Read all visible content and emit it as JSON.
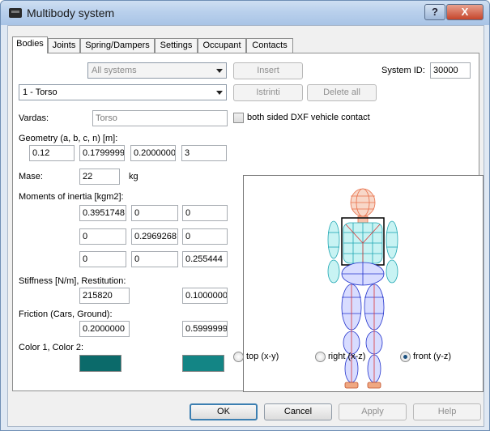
{
  "window": {
    "title": "Multibody system",
    "help_glyph": "?",
    "close_glyph": "X"
  },
  "tabs": [
    {
      "label": "Bodies"
    },
    {
      "label": "Joints"
    },
    {
      "label": "Spring/Dampers"
    },
    {
      "label": "Settings"
    },
    {
      "label": "Occupant"
    },
    {
      "label": "Contacts"
    }
  ],
  "systems_dropdown": {
    "value": "All systems"
  },
  "body_dropdown": {
    "value": "1 - Torso"
  },
  "buttons": {
    "insert": "Insert",
    "delete": "Istrinti",
    "delete_all": "Delete all",
    "ok": "OK",
    "cancel": "Cancel",
    "apply": "Apply",
    "help": "Help"
  },
  "system_id": {
    "label": "System ID:",
    "value": "30000"
  },
  "vardas": {
    "label": "Vardas:",
    "value": "Torso"
  },
  "dxf_contact": {
    "label": "both sided DXF vehicle contact",
    "checked": false
  },
  "geometry": {
    "label": "Geometry (a, b, c, n) [m]:",
    "values": [
      "0.12",
      "0.1799999",
      "0.2000000",
      "3"
    ]
  },
  "mass": {
    "label": "Mase:",
    "value": "22",
    "unit": "kg"
  },
  "inertia": {
    "label": "Moments of inertia [kgm2]:",
    "rows": [
      [
        "0.3951748",
        "0",
        "0"
      ],
      [
        "0",
        "0.2969268",
        "0"
      ],
      [
        "0",
        "0",
        "0.255444"
      ]
    ]
  },
  "stiffness": {
    "label": "Stiffness [N/m], Restitution:",
    "values": [
      "215820",
      "0.1000000"
    ]
  },
  "friction": {
    "label": "Friction (Cars, Ground):",
    "values": [
      "0.2000000",
      "0.5999999"
    ]
  },
  "colors": {
    "label": "Color 1, Color 2:",
    "color1": "#0b6a6a",
    "color2": "#138585"
  },
  "view_options": [
    {
      "label": "top (x-y)",
      "checked": false
    },
    {
      "label": "right (x-z)",
      "checked": false
    },
    {
      "label": "front (y-z)",
      "checked": true
    }
  ]
}
